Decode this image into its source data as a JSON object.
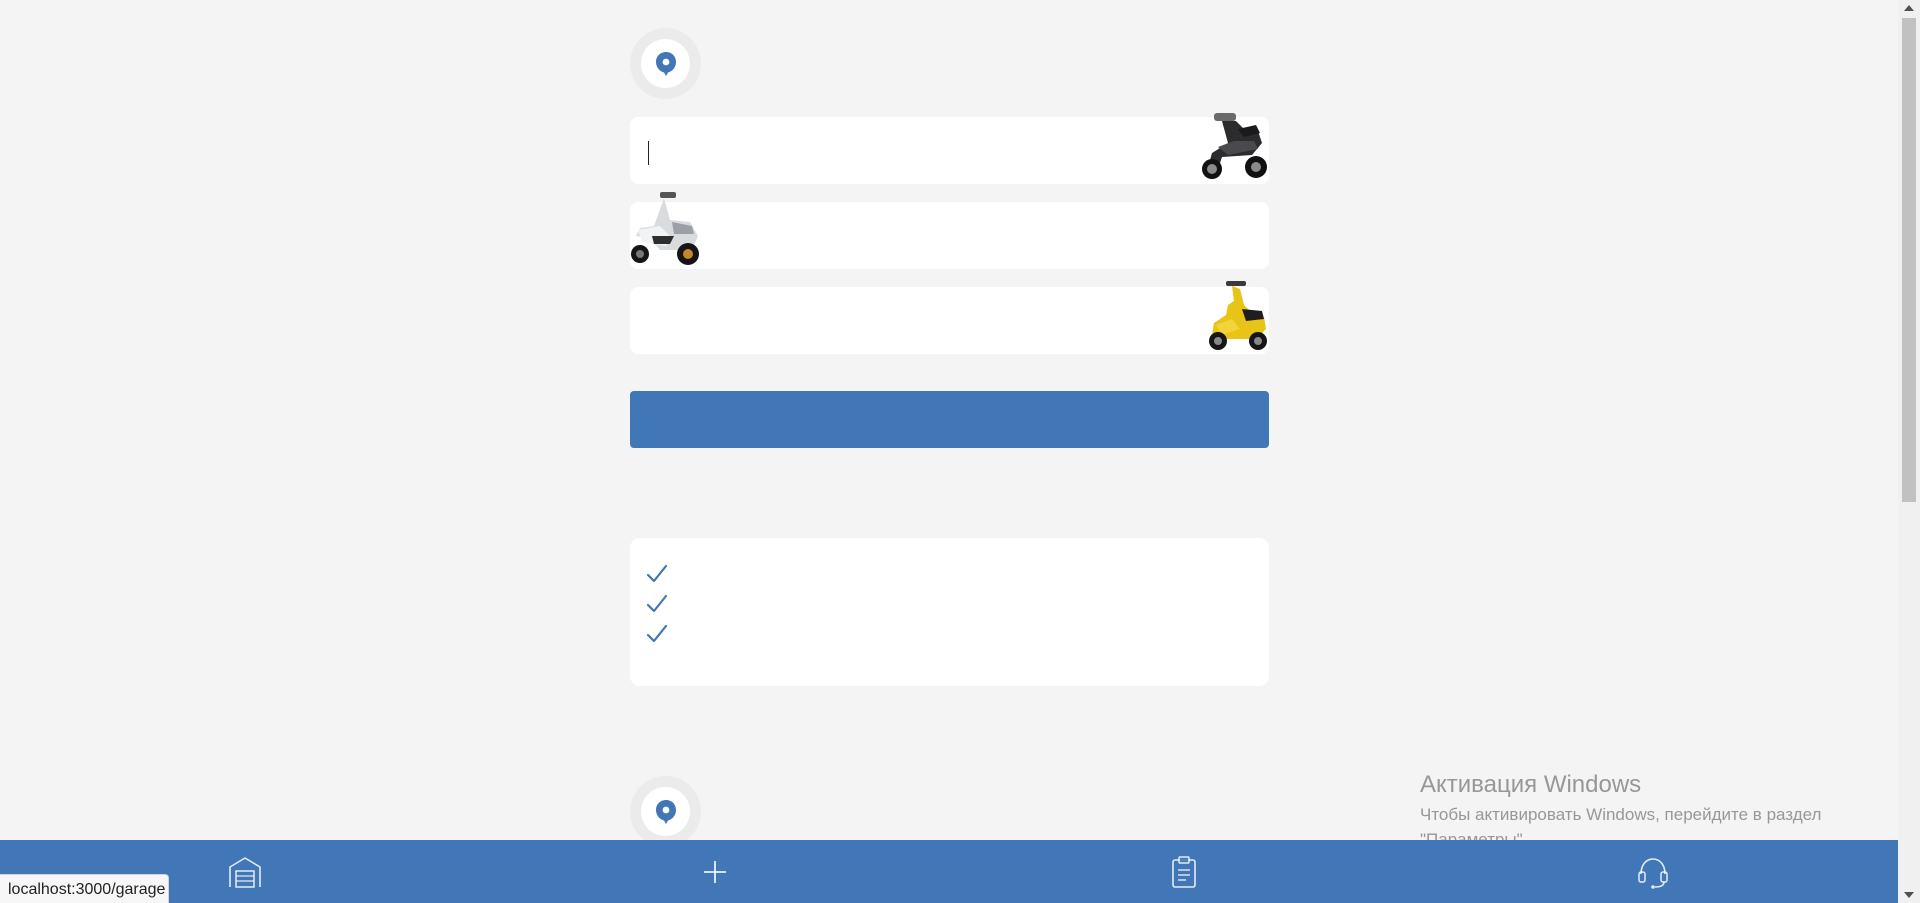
{
  "form": {
    "field_1": {
      "value": "",
      "placeholder": ""
    },
    "field_2": {
      "value": "",
      "placeholder": ""
    },
    "field_3": {
      "value": "",
      "placeholder": ""
    },
    "submit_label": ""
  },
  "features": {
    "items": [
      {
        "icon": "check-icon",
        "label": ""
      },
      {
        "icon": "check-icon",
        "label": ""
      },
      {
        "icon": "check-icon",
        "label": ""
      }
    ]
  },
  "bottom_nav": {
    "items": [
      {
        "icon": "garage-icon",
        "label": ""
      },
      {
        "icon": "plus-icon",
        "label": ""
      },
      {
        "icon": "clipboard-icon",
        "label": ""
      },
      {
        "icon": "headset-icon",
        "label": ""
      }
    ]
  },
  "status_bar": {
    "url": "localhost:3000/garage"
  },
  "windows_activation": {
    "title": "Активация Windows",
    "description_line1": "Чтобы активировать Windows, перейдите в раздел",
    "description_line2": "\"Параметры\"."
  },
  "colors": {
    "accent": "#4177b6",
    "background": "#f4f4f4",
    "card": "#ffffff",
    "scooter_yellow": "#e8c417"
  }
}
